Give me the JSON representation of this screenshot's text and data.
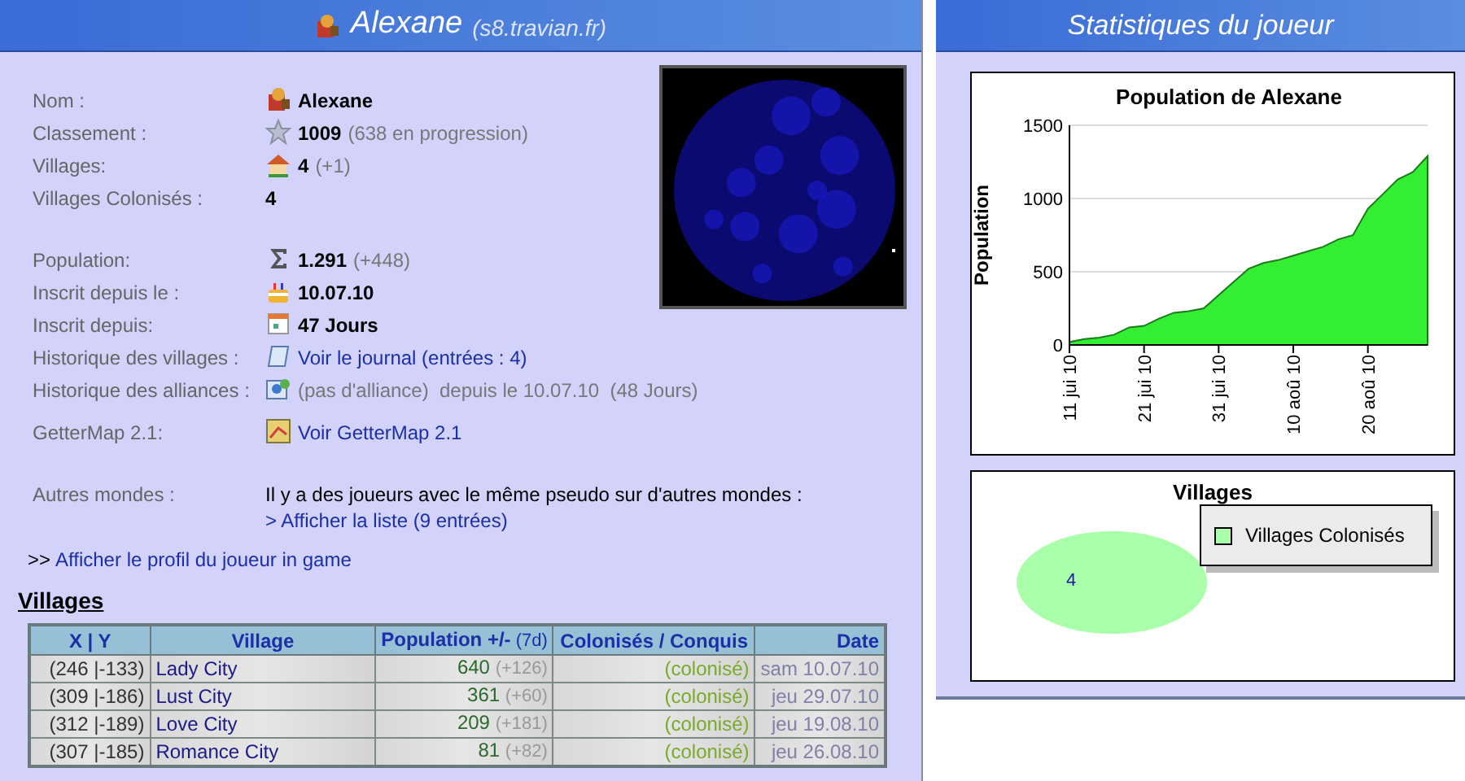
{
  "player_panel": {
    "title": "Alexane",
    "server": "(s8.travian.fr)",
    "info_groups": [
      [
        {
          "label": "Nom :",
          "kind": "value",
          "value": "Alexane"
        },
        {
          "label": "Classement :",
          "kind": "value",
          "value": "1009",
          "extra": "(638 en progression)"
        },
        {
          "label": "Villages:",
          "kind": "value",
          "value": "4",
          "extra": "(+1)"
        },
        {
          "label": "Villages Colonisés :",
          "kind": "value",
          "value": "4"
        }
      ],
      [
        {
          "label": "Population:",
          "kind": "value",
          "value": "1.291",
          "extra": "(+448)"
        },
        {
          "label": "Inscrit depuis le :",
          "kind": "value",
          "value": "10.07.10"
        },
        {
          "label": "Inscrit depuis:",
          "kind": "value",
          "value": "47 Jours"
        },
        {
          "label": "Historique des villages :",
          "kind": "link",
          "value": "Voir le journal (entrées : 4)"
        },
        {
          "label": "Historique des alliances :",
          "kind": "note",
          "value": "(pas d'alliance)  depuis le 10.07.10  (48 Jours)"
        }
      ],
      [
        {
          "label": "GetterMap 2.1:",
          "kind": "link",
          "value": "Voir GetterMap 2.1"
        }
      ],
      [
        {
          "label": "Autres mondes :",
          "kind": "text_link",
          "value": "Il y a des joueurs avec le même pseudo sur d'autres mondes :",
          "link": "> Afficher la liste (9 entrées)"
        }
      ]
    ],
    "profile_prefix": ">>",
    "profile_link": "Afficher le profil du joueur in game",
    "villages_heading": "Villages",
    "table": {
      "columns": [
        {
          "label": "X | Y"
        },
        {
          "label": "Village"
        },
        {
          "label": "Population +/-",
          "sub": "(7d)"
        },
        {
          "label": "Colonisés / Conquis"
        },
        {
          "label": "Date"
        }
      ],
      "rows": [
        {
          "coords": "(246 |-133)",
          "village": "Lady City",
          "population": "640",
          "change": "(+126)",
          "status": "(colonisé)",
          "date": "sam 10.07.10"
        },
        {
          "coords": "(309 |-186)",
          "village": "Lust City",
          "population": "361",
          "change": "(+60)",
          "status": "(colonisé)",
          "date": "jeu 29.07.10"
        },
        {
          "coords": "(312 |-189)",
          "village": "Love City",
          "population": "209",
          "change": "(+181)",
          "status": "(colonisé)",
          "date": "jeu 19.08.10"
        },
        {
          "coords": "(307 |-185)",
          "village": "Romance City",
          "population": "81",
          "change": "(+82)",
          "status": "(colonisé)",
          "date": "jeu 26.08.10"
        }
      ]
    }
  },
  "stats_panel": {
    "title": "Statistiques du joueur",
    "population_chart": {
      "chart_data": {
        "type": "area",
        "title": "Population de Alexane",
        "ylabel": "Population",
        "categories": [
          "11 jui 10",
          null,
          null,
          null,
          null,
          "21 jui 10",
          null,
          null,
          null,
          null,
          "31 jui 10",
          null,
          null,
          null,
          null,
          "10 aoû 10",
          null,
          null,
          null,
          null,
          "20 aoû 10",
          null,
          null,
          null,
          null
        ],
        "series": [
          {
            "color": "#33ee33",
            "values": [
              20,
              40,
              50,
              70,
              120,
              130,
              180,
              220,
              230,
              250,
              340,
              430,
              520,
              560,
              580,
              610,
              640,
              670,
              720,
              750,
              930,
              1030,
              1130,
              1180,
              1290
            ]
          }
        ],
        "ylim": [
          0,
          1500
        ],
        "yticks": [
          0,
          500,
          1000,
          1500
        ]
      }
    },
    "villages_chart": {
      "chart_data": {
        "type": "pie",
        "title": "Villages",
        "categories": [
          "Villages Colonisés"
        ],
        "series": [
          {
            "color": "#aaffaa",
            "values": [
              4
            ]
          }
        ],
        "data_labels": true
      }
    }
  }
}
